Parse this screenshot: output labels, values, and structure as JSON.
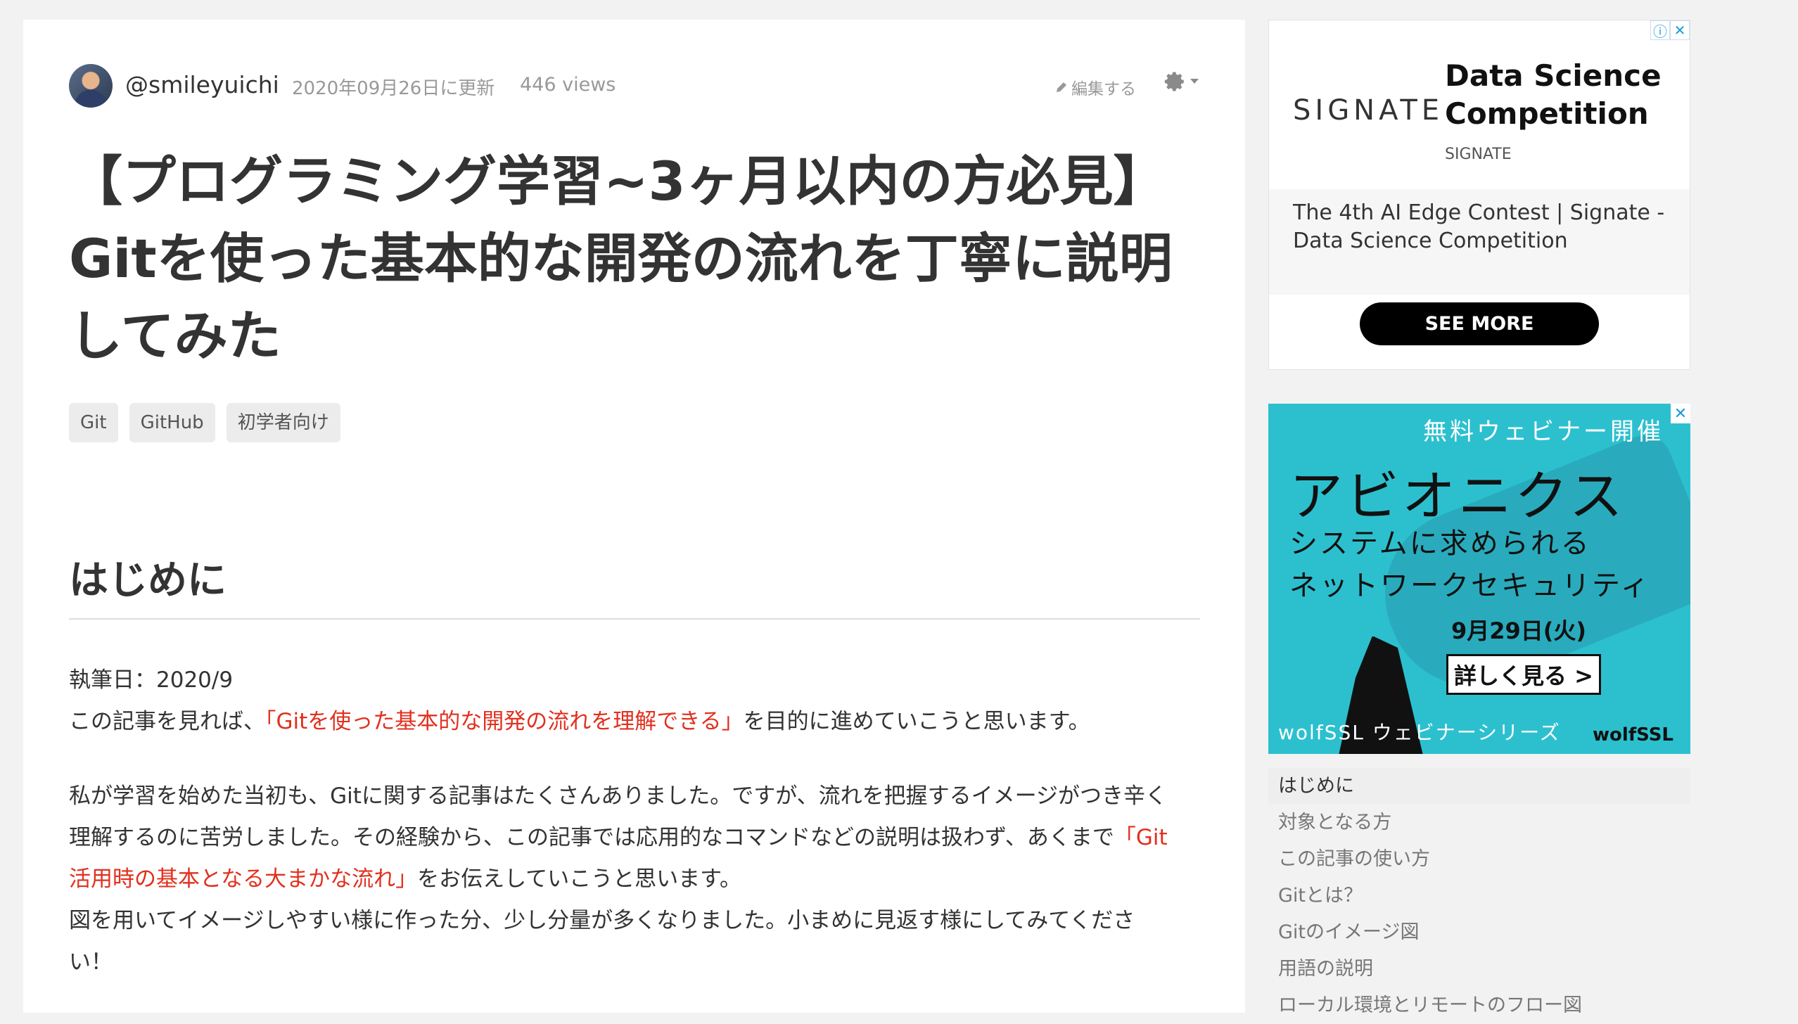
{
  "author": {
    "name": "@smileyuichi",
    "updated": "2020年09月26日に更新",
    "views": "446 views"
  },
  "actions": {
    "edit_label": "編集する"
  },
  "article": {
    "title": "【プログラミング学習~3ヶ月以内の方必見】Gitを使った基本的な開発の流れを丁寧に説明してみた",
    "tags": [
      "Git",
      "GitHub",
      "初学者向け"
    ],
    "section_title": "はじめに",
    "p1_line1": "執筆日：2020/9",
    "p1_line2_pre": "この記事を見れば、",
    "p1_line2_red": "「Gitを使った基本的な開発の流れを理解できる」",
    "p1_line2_post": "を目的に進めていこうと思います。",
    "p2_line1": "私が学習を始めた当初も、Gitに関する記事はたくさんありました。ですが、流れを把握するイメージがつき辛く",
    "p2_line2_pre": "理解するのに苦労しました。その経験から、この記事では応用的なコマンドなどの説明は扱わず、あくまで",
    "p2_line2_red": "「Git",
    "p2_line3_red": "活用時の基本となる大まかな流れ」",
    "p2_line3_post": "をお伝えしていこうと思います。",
    "p3_line1": "図を用いてイメージしやすい様に作った分、少し分量が多くなりました。小まめに見返す様にしてみてくださ",
    "p3_line2": "い！"
  },
  "ad1": {
    "logo": "SIGNATE",
    "headline_line1": "Data Science",
    "headline_line2": "Competition",
    "brand": "SIGNATE",
    "desc_line1": "The 4th AI Edge Contest | Signate -",
    "desc_line2": "Data Science Competition",
    "cta": "SEE MORE"
  },
  "ad2": {
    "top": "無料ウェビナー開催",
    "big": "アビオニクス",
    "line1": "システムに求められる",
    "line2": "ネットワークセキュリティ",
    "date": "9月29日(火)",
    "button": "詳しく見る >",
    "series": "wolfSSL ウェビナーシリーズ",
    "brand": "wolfSSL"
  },
  "toc": [
    "はじめに",
    "対象となる方",
    "この記事の使い方",
    "Gitとは？",
    "Gitのイメージ図",
    "用語の説明",
    "ローカル環境とリモートのフロー図"
  ]
}
